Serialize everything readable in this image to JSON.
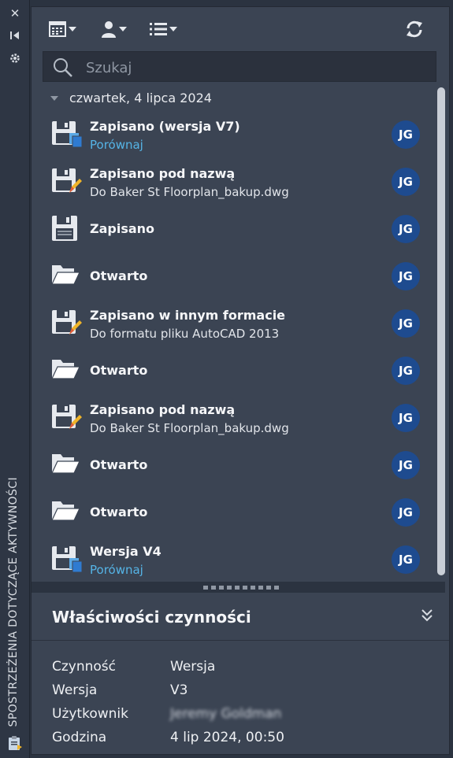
{
  "palette_title": "SPOSTRZEŻENIA DOTYCZĄCE AKTYWNOŚCI",
  "strip_icons": [
    "close-icon",
    "collapse-panel-icon",
    "settings-icon",
    "clipboard-icon"
  ],
  "toolbar": {
    "buttons": [
      "calendar-filter-icon",
      "user-filter-icon",
      "list-filter-icon",
      "refresh-icon"
    ]
  },
  "search": {
    "placeholder": "Szukaj",
    "value": ""
  },
  "date_group": "czwartek, 4 lipca 2024",
  "activities": [
    {
      "title": "Zapisano (wersja V7)",
      "subtitle": "Porównaj",
      "subtitle_is_link": true,
      "icon": "save-version-icon",
      "user": "JG"
    },
    {
      "title": "Zapisano pod nazwą",
      "subtitle": "Do Baker St Floorplan_bakup.dwg",
      "subtitle_is_link": false,
      "icon": "save-as-icon",
      "user": "JG"
    },
    {
      "title": "Zapisano",
      "subtitle": "",
      "subtitle_is_link": false,
      "icon": "save-icon",
      "user": "JG"
    },
    {
      "title": "Otwarto",
      "subtitle": "",
      "subtitle_is_link": false,
      "icon": "open-folder-icon",
      "user": "JG"
    },
    {
      "title": "Zapisano w innym formacie",
      "subtitle": "Do formatu pliku AutoCAD 2013",
      "subtitle_is_link": false,
      "icon": "save-as-icon",
      "user": "JG"
    },
    {
      "title": "Otwarto",
      "subtitle": "",
      "subtitle_is_link": false,
      "icon": "open-folder-icon",
      "user": "JG"
    },
    {
      "title": "Zapisano pod nazwą",
      "subtitle": "Do Baker St Floorplan_bakup.dwg",
      "subtitle_is_link": false,
      "icon": "save-as-icon",
      "user": "JG"
    },
    {
      "title": "Otwarto",
      "subtitle": "",
      "subtitle_is_link": false,
      "icon": "open-folder-icon",
      "user": "JG"
    },
    {
      "title": "Otwarto",
      "subtitle": "",
      "subtitle_is_link": false,
      "icon": "open-folder-icon",
      "user": "JG"
    },
    {
      "title": "Wersja V4",
      "subtitle": "Porównaj",
      "subtitle_is_link": true,
      "icon": "save-version-icon",
      "user": "JG"
    }
  ],
  "properties": {
    "title": "Właściwości czynności",
    "rows": [
      {
        "key": "Czynność",
        "value": "Wersja"
      },
      {
        "key": "Wersja",
        "value": "V3"
      },
      {
        "key": "Użytkownik",
        "value": "Jeremy Goldman"
      },
      {
        "key": "Godzina",
        "value": "4 lip 2024, 00:50"
      }
    ]
  },
  "colors": {
    "accent_link": "#55b4e6",
    "avatar_bg": "#1e4b8f",
    "panel_bg": "#3b4453"
  }
}
